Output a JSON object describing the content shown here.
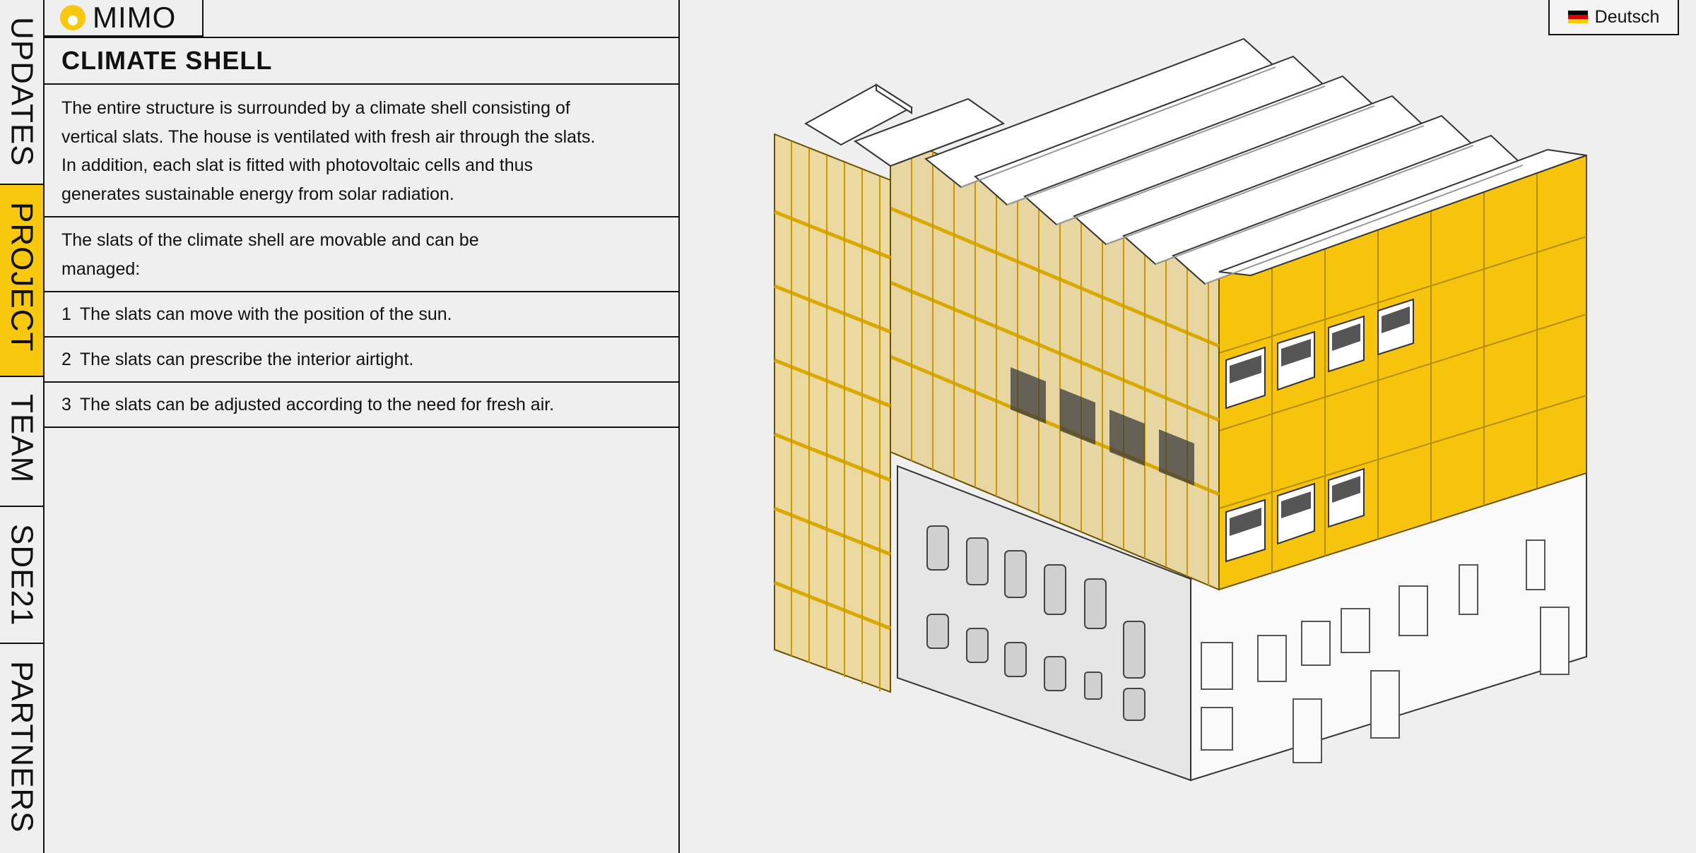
{
  "nav": {
    "items": [
      {
        "label": "UPDATES",
        "active": false
      },
      {
        "label": "PROJECT",
        "active": true
      },
      {
        "label": "TEAM",
        "active": false
      },
      {
        "label": "SDE21",
        "active": false
      },
      {
        "label": "PARTNERS",
        "active": false
      }
    ]
  },
  "brand": {
    "name": "MIMO",
    "logo_color": "#f8c80e"
  },
  "section": {
    "title": "CLIMATE SHELL",
    "paragraph_1": "The entire structure is surrounded by a climate shell consisting of vertical slats. The house is ventilated with fresh air through the slats. In addition, each slat is fitted with photovoltaic cells and thus generates sustainable energy from solar radiation.",
    "paragraph_2": "The slats of the climate shell are movable and can be managed:",
    "points": [
      {
        "num": "1",
        "text": "The slats can move with the position of the sun."
      },
      {
        "num": "2",
        "text": "The slats can prescribe the interior airtight."
      },
      {
        "num": "3",
        "text": "The slats can be adjusted according to the need for fresh air."
      }
    ]
  },
  "language": {
    "label": "Deutsch",
    "flag_icon": "german-flag-icon"
  },
  "colors": {
    "accent": "#f8c80e",
    "background": "#efefef",
    "line": "#111111"
  },
  "illustration": {
    "icon": "isometric-building-illustration"
  }
}
